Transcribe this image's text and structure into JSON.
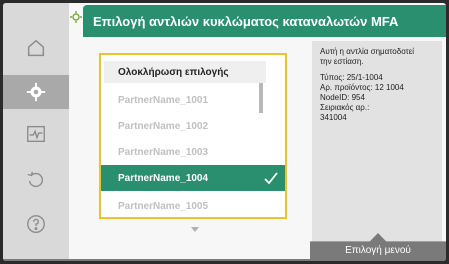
{
  "title": "Επιλογή αντλιών κυκλώματος καταναλωτών MFA",
  "nav": {
    "items": [
      {
        "icon": "home-icon"
      },
      {
        "icon": "settings-gear-icon",
        "active": true
      },
      {
        "icon": "diagnostics-monitor-icon"
      },
      {
        "icon": "restore-back-icon"
      },
      {
        "icon": "help-question-icon"
      }
    ]
  },
  "list": {
    "header": "Ολοκλήρωση επιλογής",
    "items": [
      {
        "label": "PartnerName_1001"
      },
      {
        "label": "PartnerName_1002"
      },
      {
        "label": "PartnerName_1003"
      },
      {
        "label": "PartnerName_1004",
        "selected": true
      },
      {
        "label": "PartnerName_1005"
      }
    ]
  },
  "info": {
    "line1": "Αυτή η αντλία σηματοδοτεί",
    "line2": "την εστίαση.",
    "type": "Τύπος: 25/1-1004",
    "product_no": "Αρ. προϊόντος: 12 1004",
    "node_id": "NodeID: 954",
    "serial_label": "Σειριακός αρ.:",
    "serial_value": "341004"
  },
  "menu_button": "Επιλογή μενού",
  "colors": {
    "accent": "#2a8f6e",
    "focus": "#f0c12a",
    "nav": "#d9d9d9"
  }
}
